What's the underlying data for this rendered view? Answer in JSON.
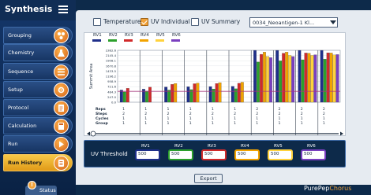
{
  "app": {
    "title": "Synthesis"
  },
  "sidebar": {
    "items": [
      {
        "label": "Grouping",
        "active": false,
        "icon": "grouping-icon"
      },
      {
        "label": "Chemistry",
        "active": false,
        "icon": "chemistry-icon"
      },
      {
        "label": "Sequence",
        "active": false,
        "icon": "sequence-icon"
      },
      {
        "label": "Setup",
        "active": false,
        "icon": "setup-icon"
      },
      {
        "label": "Protocol",
        "active": false,
        "icon": "protocol-icon"
      },
      {
        "label": "Calculation",
        "active": false,
        "icon": "calculation-icon"
      },
      {
        "label": "Run",
        "active": false,
        "icon": "run-icon"
      },
      {
        "label": "Run History",
        "active": true,
        "icon": "run-history-icon"
      }
    ]
  },
  "filters": {
    "temperature": {
      "label": "Temperature",
      "checked": false
    },
    "uv_individual": {
      "label": "UV Individual",
      "checked": true
    },
    "uv_summary": {
      "label": "UV Summary",
      "checked": false
    }
  },
  "sample_select": {
    "value": "0034_Neoantigen-1 Kl..."
  },
  "chart_data": {
    "type": "bar",
    "ylabel": "Summit Area",
    "ytick_labels": [
      "2382.6",
      "2145.4",
      "1908.1",
      "1670.8",
      "1433.5",
      "1196.2",
      "958.9",
      "721.6",
      "484.3",
      "247.0",
      "0.0"
    ],
    "ylim": [
      0,
      2382.6
    ],
    "threshold_line": 500,
    "series": [
      {
        "name": "RV1",
        "color": "#1f2f8a"
      },
      {
        "name": "RV2",
        "color": "#2ca02c"
      },
      {
        "name": "RV3",
        "color": "#d12a2a"
      },
      {
        "name": "RV4",
        "color": "#f2a300"
      },
      {
        "name": "RV5",
        "color": "#ffd23c"
      },
      {
        "name": "RV6",
        "color": "#7a3fbf"
      }
    ],
    "groups": [
      {
        "values": [
          560,
          470,
          640,
          0,
          0,
          0
        ]
      },
      {
        "values": [
          600,
          510,
          690,
          0,
          0,
          0
        ]
      },
      {
        "values": [
          700,
          560,
          820,
          860,
          0,
          0
        ]
      },
      {
        "values": [
          710,
          580,
          850,
          880,
          0,
          0
        ]
      },
      {
        "values": [
          720,
          610,
          860,
          900,
          0,
          0
        ]
      },
      {
        "values": [
          730,
          620,
          870,
          920,
          0,
          0
        ]
      },
      {
        "values": [
          2382,
          1850,
          2200,
          2300,
          2100,
          2050
        ]
      },
      {
        "values": [
          2382,
          1900,
          2250,
          2300,
          2150,
          2100
        ]
      },
      {
        "values": [
          2382,
          1950,
          2260,
          2250,
          2150,
          2180
        ]
      },
      {
        "values": [
          2382,
          1980,
          2270,
          2260,
          2170,
          2190
        ]
      }
    ],
    "table": {
      "row_labels": [
        "Reps",
        "Steps",
        "Cycles",
        "Group"
      ],
      "columns": [
        [
          "1",
          "2",
          "1",
          "1"
        ],
        [
          "1",
          "2",
          "1",
          "1"
        ],
        [
          "1",
          "2",
          "1",
          "1"
        ],
        [
          "1",
          "2",
          "1",
          "1"
        ],
        [
          "1",
          "2",
          "1",
          "1"
        ],
        [
          "1",
          "2",
          "1",
          "1"
        ],
        [
          "2",
          "2",
          "1",
          "1"
        ],
        [
          "2",
          "2",
          "1",
          "1"
        ],
        [
          "2",
          "2",
          "1",
          "1"
        ],
        [
          "2",
          "2",
          "1",
          "1"
        ]
      ]
    }
  },
  "uv_threshold": {
    "title": "UV Threshold",
    "channels": [
      {
        "label": "RV1",
        "value": "500",
        "color": "#1f2f8a"
      },
      {
        "label": "RV2",
        "value": "500",
        "color": "#2ca02c"
      },
      {
        "label": "RV3",
        "value": "500",
        "color": "#d12a2a"
      },
      {
        "label": "RV4",
        "value": "500",
        "color": "#f2a300"
      },
      {
        "label": "RV5",
        "value": "500",
        "color": "#ffd23c"
      },
      {
        "label": "RV6",
        "value": "500",
        "color": "#7a3fbf"
      }
    ]
  },
  "export_button": {
    "label": "Export"
  },
  "footer": {
    "status_label": "Status",
    "status_icon": "!",
    "brand_prefix": "PurePep",
    "brand_suffix": "Chorus"
  }
}
